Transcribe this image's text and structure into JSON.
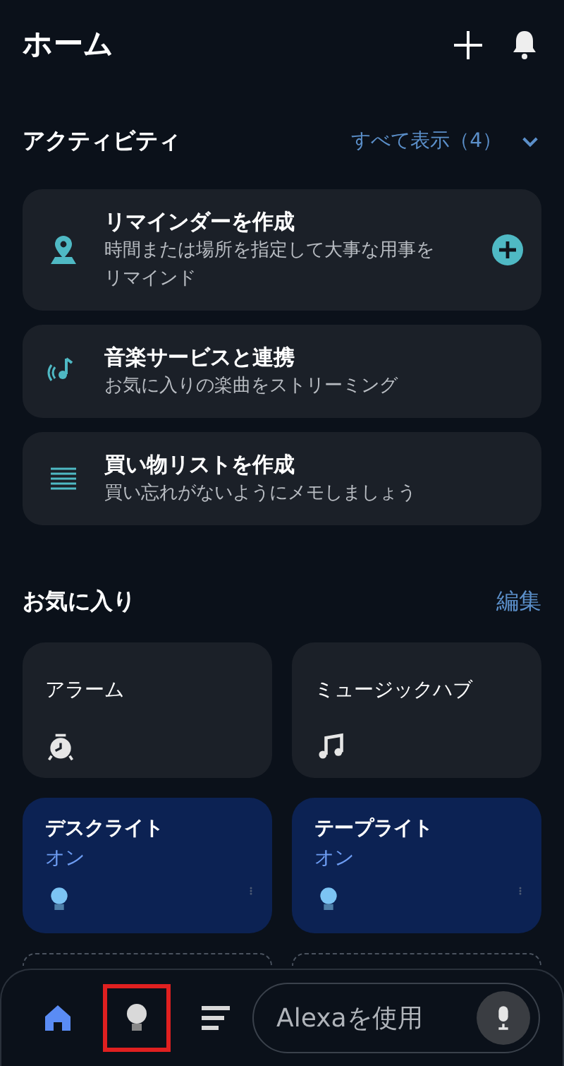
{
  "header": {
    "title": "ホーム"
  },
  "activity": {
    "title": "アクティビティ",
    "see_all": "すべて表示（4）",
    "expanded": false,
    "cards": [
      {
        "kind": "reminder",
        "title": "リマインダーを作成",
        "subtitle": "時間または場所を指定して大事な用事をリマインド",
        "add": true
      },
      {
        "kind": "music",
        "title": "音楽サービスと連携",
        "subtitle": "お気に入りの楽曲をストリーミング",
        "add": false
      },
      {
        "kind": "list",
        "title": "買い物リストを作成",
        "subtitle": "買い忘れがないようにメモしましょう",
        "add": false
      }
    ]
  },
  "favorites": {
    "title": "お気に入り",
    "edit": "編集",
    "tiles": [
      {
        "kind": "alarm",
        "name": "アラーム"
      },
      {
        "kind": "music",
        "name": "ミュージックハブ"
      },
      {
        "kind": "light",
        "name": "デスクライト",
        "status": "オン",
        "on": true
      },
      {
        "kind": "light",
        "name": "テープライト",
        "status": "オン",
        "on": true
      },
      {
        "kind": "placeholder"
      },
      {
        "kind": "placeholder"
      }
    ]
  },
  "bottom_nav": {
    "items": [
      {
        "kind": "home",
        "selected": true,
        "highlighted": false
      },
      {
        "kind": "devices",
        "selected": false,
        "highlighted": true
      },
      {
        "kind": "more",
        "selected": false,
        "highlighted": false
      }
    ],
    "alexa": {
      "placeholder": "Alexaを使用"
    }
  }
}
